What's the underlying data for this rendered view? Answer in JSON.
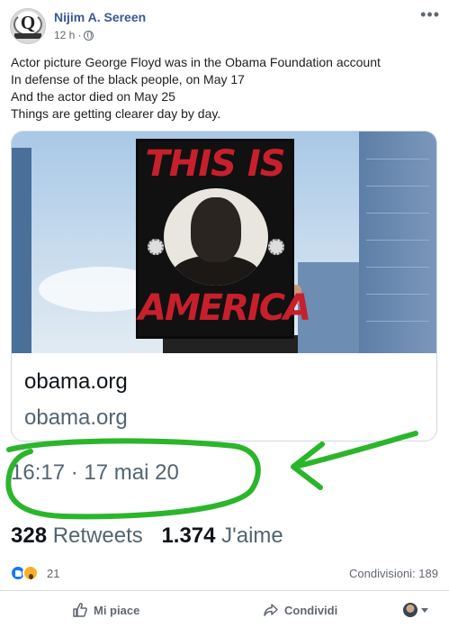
{
  "post": {
    "author": "Nijim A. Sereen",
    "time": "12 h",
    "separator": "·",
    "lines": [
      "Actor picture George Floyd was in the Obama Foundation account",
      "In defense of the black people, on May 17",
      "And the actor died on May 25",
      "Things are getting clearer day by day."
    ]
  },
  "embedded_tweet": {
    "sign_text_top": "THIS IS",
    "sign_text_bottom": "AMERICA",
    "link_title": "obama.org",
    "link_domain": "obama.org",
    "timestamp": "16:17 · 17 mai 20",
    "retweets_count": "328",
    "retweets_label": "Retweets",
    "likes_count": "1.374",
    "likes_label": "J'aime",
    "annotation_color": "#2bb52b"
  },
  "reactions": {
    "count": "21",
    "shares": "Condivisioni: 189"
  },
  "actions": {
    "like": "Mi piace",
    "share": "Condividi"
  },
  "colors": {
    "author_link": "#385898",
    "like_blue": "#1877f2",
    "wow_yellow": "#f7b125",
    "muted": "#606770"
  }
}
